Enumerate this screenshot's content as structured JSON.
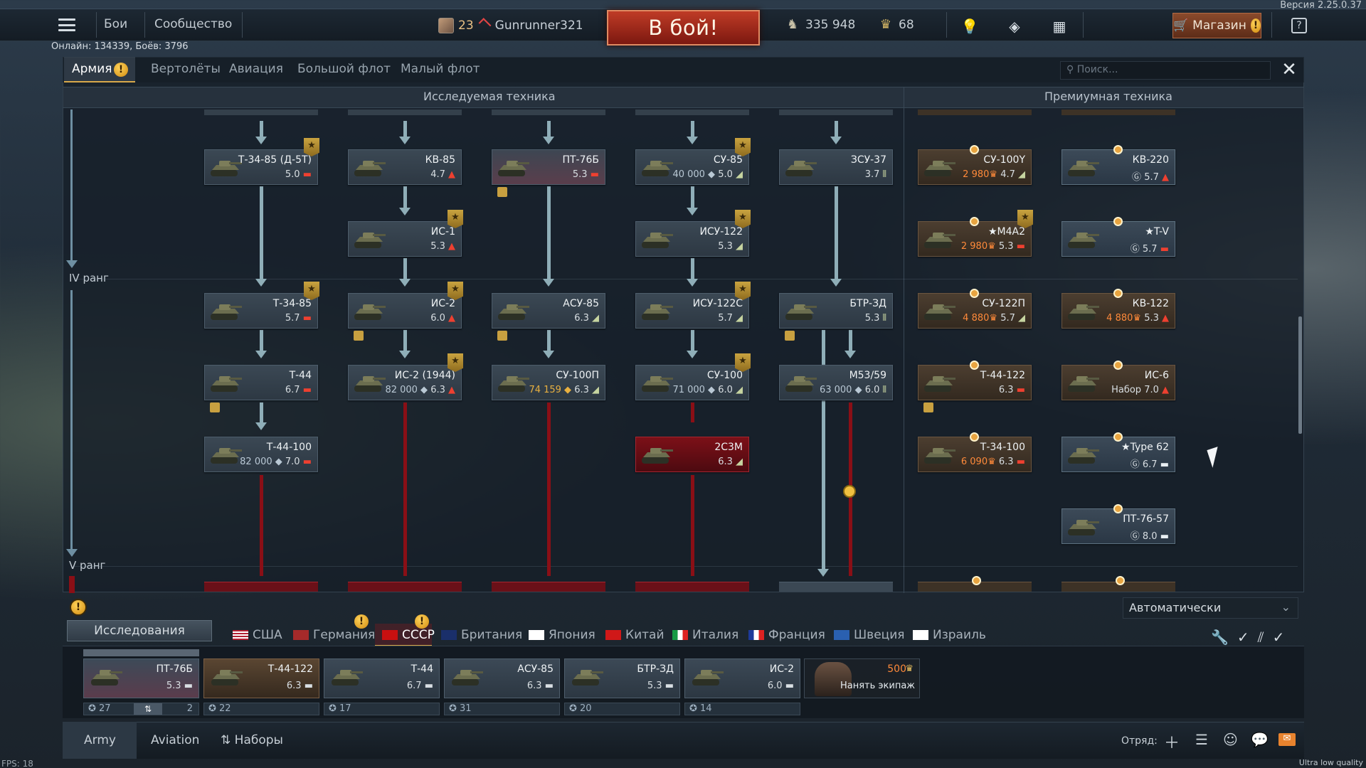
{
  "version": "Версия 2.25.0.37",
  "topbar": {
    "links": [
      "Бои",
      "Сообщество"
    ],
    "player": {
      "level": "23",
      "name": "Gunrunner321"
    },
    "battle_button": "В бой!",
    "silver_lions": "335 948",
    "golden_eagles": "68",
    "shop_label": "Магазин",
    "help": "?"
  },
  "online": "Онлайн: 134339, Боёв: 3796",
  "tabs": [
    "Армия",
    "Вертолёты",
    "Авиация",
    "Большой флот",
    "Малый флот"
  ],
  "search_placeholder": "Поиск...",
  "sections": {
    "research": "Исследуемая техника",
    "premium": "Премиумная техника"
  },
  "ranks": [
    "IV ранг",
    "V ранг"
  ],
  "tree": [
    {
      "name": "Т-34-85 (Д-5Т)",
      "br": "5.0",
      "type": "medium",
      "style": "normal"
    },
    {
      "name": "КВ-85",
      "br": "4.7",
      "type": "heavy",
      "style": "normal"
    },
    {
      "name": "ПТ-76Б",
      "br": "5.3",
      "type": "light",
      "style": "pink"
    },
    {
      "name": "СУ-85",
      "br": "5.0",
      "rp": "40 000",
      "type": "td",
      "style": "normal"
    },
    {
      "name": "ЗСУ-37",
      "br": "3.7",
      "type": "spaa",
      "style": "normal"
    },
    {
      "name": "ИС-1",
      "br": "5.3",
      "type": "heavy",
      "style": "normal"
    },
    {
      "name": "ИСУ-122",
      "br": "5.3",
      "type": "td",
      "style": "normal"
    },
    {
      "name": "Т-34-85",
      "br": "5.7",
      "type": "medium",
      "style": "normal"
    },
    {
      "name": "ИС-2",
      "br": "6.0",
      "type": "heavy",
      "style": "normal"
    },
    {
      "name": "АСУ-85",
      "br": "6.3",
      "type": "td",
      "style": "normal"
    },
    {
      "name": "ИСУ-122С",
      "br": "5.7",
      "type": "td",
      "style": "normal"
    },
    {
      "name": "БТР-ЗД",
      "br": "5.3",
      "type": "spaa",
      "style": "normal"
    },
    {
      "name": "Т-44",
      "br": "6.7",
      "type": "medium",
      "style": "normal"
    },
    {
      "name": "ИС-2 (1944)",
      "br": "6.3",
      "rp": "82 000",
      "type": "heavy",
      "style": "normal"
    },
    {
      "name": "СУ-100П",
      "br": "6.3",
      "rp": "74 159",
      "type": "td",
      "style": "normal"
    },
    {
      "name": "СУ-100",
      "br": "6.0",
      "rp": "71 000",
      "type": "td",
      "style": "normal"
    },
    {
      "name": "М53/59",
      "br": "6.0",
      "rp": "63 000",
      "type": "spaa",
      "style": "normal"
    },
    {
      "name": "Т-44-100",
      "br": "7.0",
      "rp": "82 000",
      "type": "medium",
      "style": "normal"
    },
    {
      "name": "2С3М",
      "br": "6.3",
      "type": "td",
      "style": "red"
    }
  ],
  "premium": [
    {
      "name": "СУ-100Y",
      "br": "4.7",
      "price": "2 980",
      "type": "td"
    },
    {
      "name": "КВ-220",
      "br": "5.7",
      "type": "heavy",
      "squad": true
    },
    {
      "name": "★M4A2",
      "br": "5.3",
      "price": "2 980",
      "type": "medium"
    },
    {
      "name": "★T-V",
      "br": "5.7",
      "type": "medium",
      "squad": true
    },
    {
      "name": "СУ-122П",
      "br": "5.7",
      "price": "4 880",
      "type": "td"
    },
    {
      "name": "КВ-122",
      "br": "5.3",
      "price": "4 880",
      "type": "heavy"
    },
    {
      "name": "Т-44-122",
      "br": "6.3",
      "type": "medium"
    },
    {
      "name": "ИС-6",
      "br": "7.0",
      "prefix": "Набор",
      "type": "heavy"
    },
    {
      "name": "Т-34-100",
      "br": "6.3",
      "price": "6 090",
      "type": "medium"
    },
    {
      "name": "★Type 62",
      "br": "6.7",
      "type": "light",
      "squad": true
    },
    {
      "name": "ПТ-76-57",
      "br": "8.0",
      "type": "light",
      "squad": true
    }
  ],
  "bottom": {
    "auto_select": "Автоматически",
    "research_button": "Исследования",
    "nations": [
      "США",
      "Германия",
      "СССР",
      "Британия",
      "Япония",
      "Китай",
      "Италия",
      "Франция",
      "Швеция",
      "Израиль"
    ],
    "active_nation": "СССР",
    "crew": [
      {
        "name": "ПТ-76Б",
        "br": "5.3",
        "num": "27",
        "extra": "2"
      },
      {
        "name": "Т-44-122",
        "br": "6.3",
        "num": "22"
      },
      {
        "name": "Т-44",
        "br": "6.7",
        "num": "17"
      },
      {
        "name": "АСУ-85",
        "br": "6.3",
        "num": "31"
      },
      {
        "name": "БТР-ЗД",
        "br": "5.3",
        "num": "20"
      },
      {
        "name": "ИС-2",
        "br": "6.0",
        "num": "14"
      }
    ],
    "hire": {
      "price": "500",
      "label": "Нанять экипаж"
    },
    "tabs": [
      "Army",
      "Aviation",
      "Наборы"
    ],
    "squad_label": "Отряд:"
  },
  "fps": "FPS: 18",
  "quality": "Ultra low quality"
}
